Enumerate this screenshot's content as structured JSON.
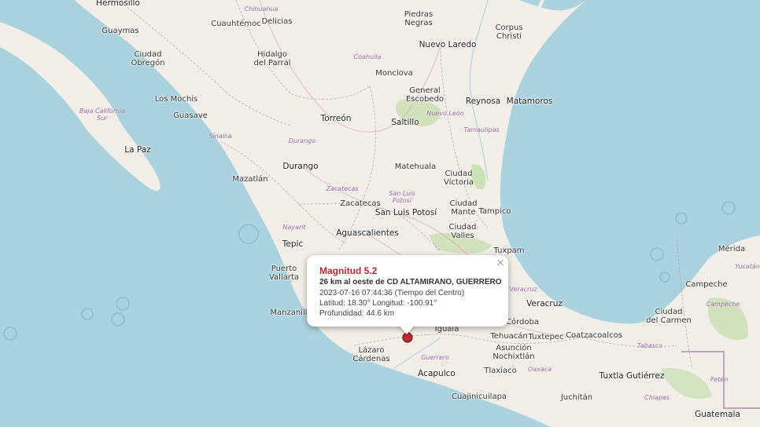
{
  "map": {
    "colors": {
      "water": "#aad3df",
      "land": "#f2efe9",
      "forest": "#c8dfb0",
      "border": "#b296b8"
    },
    "cities": [
      {
        "id": "hermosillo",
        "name": "Hermosillo"
      },
      {
        "id": "guaymas",
        "name": "Guaymas"
      },
      {
        "id": "cuauhtemoc",
        "name": "Cuauhtémoc"
      },
      {
        "id": "delicias",
        "name": "Delicias"
      },
      {
        "id": "piedras-negras",
        "name": "Piedras\nNegras"
      },
      {
        "id": "nuevo-laredo",
        "name": "Nuevo Laredo"
      },
      {
        "id": "corpus-christi",
        "name": "Corpus\nChristi"
      },
      {
        "id": "ciudad-obregon",
        "name": "Ciudad\nObregón"
      },
      {
        "id": "hidalgo-parral",
        "name": "Hidalgo\ndel Parral"
      },
      {
        "id": "monclova",
        "name": "Monclova"
      },
      {
        "id": "los-mochis",
        "name": "Los Mochis"
      },
      {
        "id": "guasave",
        "name": "Guasave"
      },
      {
        "id": "general-escobedo",
        "name": "General\nEscobedo"
      },
      {
        "id": "reynosa",
        "name": "Reynosa"
      },
      {
        "id": "matamoros",
        "name": "Matamoros"
      },
      {
        "id": "torreon",
        "name": "Torreón"
      },
      {
        "id": "saltillo",
        "name": "Saltillo"
      },
      {
        "id": "la-paz",
        "name": "La Paz"
      },
      {
        "id": "durango",
        "name": "Durango"
      },
      {
        "id": "matehuala",
        "name": "Matehuala"
      },
      {
        "id": "ciudad-victoria",
        "name": "Ciudad\nVictoria"
      },
      {
        "id": "mazatlan",
        "name": "Mazatlán"
      },
      {
        "id": "zacatecas",
        "name": "Zacatecas"
      },
      {
        "id": "san-luis-potosi",
        "name": "San Luis Potosí"
      },
      {
        "id": "ciudad-mante",
        "name": "Ciudad\nMante"
      },
      {
        "id": "tampico",
        "name": "Tampico"
      },
      {
        "id": "aguascalientes",
        "name": "Aguascalientes"
      },
      {
        "id": "ciudad-valles",
        "name": "Ciudad\nValles"
      },
      {
        "id": "tepic",
        "name": "Tepic"
      },
      {
        "id": "tuxpam",
        "name": "Tuxpam"
      },
      {
        "id": "merida",
        "name": "Mérida"
      },
      {
        "id": "puerto-vallarta",
        "name": "Puerto\nVallarta"
      },
      {
        "id": "campeche",
        "name": "Campeche"
      },
      {
        "id": "veracruz",
        "name": "Veracruz"
      },
      {
        "id": "manzanillo",
        "name": "Manzanillo"
      },
      {
        "id": "ciudad-del-carmen",
        "name": "Ciudad\ndel Carmen"
      },
      {
        "id": "cordoba",
        "name": "Córdoba"
      },
      {
        "id": "iguala",
        "name": "Iguala"
      },
      {
        "id": "tehuacan",
        "name": "Tehuacán"
      },
      {
        "id": "tuxtepec",
        "name": "Tuxtepec"
      },
      {
        "id": "coatzacoalcos",
        "name": "Coatzacoalcos"
      },
      {
        "id": "lazaro-cardenas",
        "name": "Lázaro\nCárdenas"
      },
      {
        "id": "asuncion-nochixtlan",
        "name": "Asunción\nNochixtlán"
      },
      {
        "id": "acapulco",
        "name": "Acapulco"
      },
      {
        "id": "tlaxiaco",
        "name": "Tlaxiaco"
      },
      {
        "id": "tuxtla-gutierrez",
        "name": "Tuxtla Gutiérrez"
      },
      {
        "id": "cuajinicuilapa",
        "name": "Cuajinicuilapa"
      },
      {
        "id": "juchitan",
        "name": "Juchitán"
      },
      {
        "id": "guatemala",
        "name": "Guatemala"
      }
    ],
    "regions": [
      {
        "id": "chihuahua",
        "name": "Chihuahua"
      },
      {
        "id": "coahuila",
        "name": "Coahuila"
      },
      {
        "id": "baja-california-sur",
        "name": "Baja California\nSur"
      },
      {
        "id": "nuevo-leon",
        "name": "Nuevo León"
      },
      {
        "id": "tamaulipas",
        "name": "Tamaulipas"
      },
      {
        "id": "sinaloa",
        "name": "Sinaloa"
      },
      {
        "id": "durango-state",
        "name": "Durango"
      },
      {
        "id": "zacatecas-state",
        "name": "Zacatecas"
      },
      {
        "id": "san-luis-potosi-state",
        "name": "San Luis\nPotosí"
      },
      {
        "id": "nayarit",
        "name": "Nayarit"
      },
      {
        "id": "veracruz-state",
        "name": "Veracruz"
      },
      {
        "id": "guerrero",
        "name": "Guerrero"
      },
      {
        "id": "oaxaca",
        "name": "Oaxaca"
      },
      {
        "id": "tabasco",
        "name": "Tabasco"
      },
      {
        "id": "campeche-state",
        "name": "Campeche"
      },
      {
        "id": "yucatan",
        "name": "Yucatán"
      },
      {
        "id": "chiapas",
        "name": "Chiapas"
      },
      {
        "id": "peten",
        "name": "Petén"
      }
    ]
  },
  "popup": {
    "title": "Magnitud 5.2",
    "location": "26 km al oeste de CD ALTAMIRANO, GUERRERO",
    "datetime": "2023-07-16  07:44:36 (Tiempo del Centro)",
    "coords": "Latitud: 18.30°  Longitud: -100.91°",
    "depth": "Profundidad: 44.6 km",
    "close": "×"
  },
  "marker": {
    "color": "#c0282d",
    "latitude": 18.3,
    "longitude": -100.91
  }
}
